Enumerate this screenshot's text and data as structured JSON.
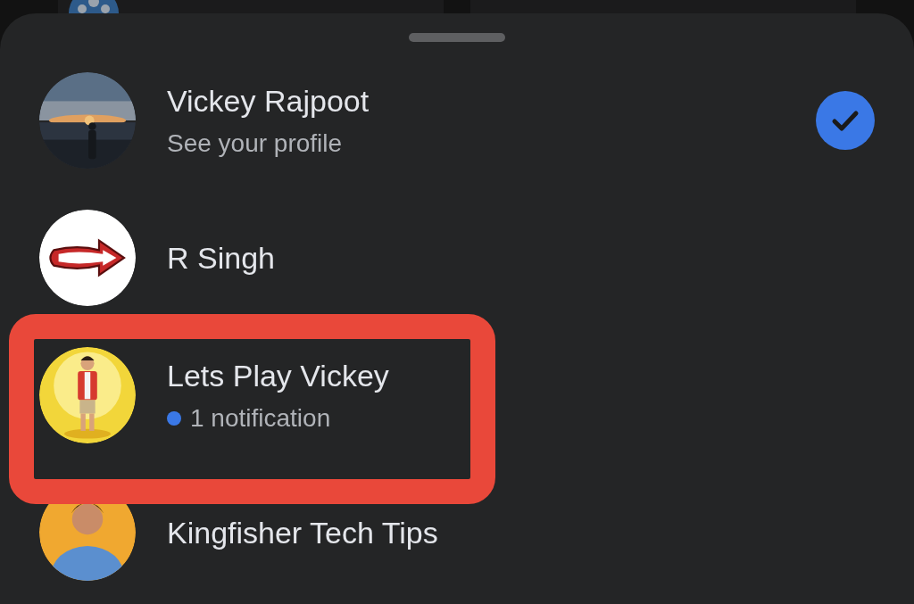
{
  "sheet": {
    "accounts": [
      {
        "name": "Vickey Rajpoot",
        "subtitle": "See your profile",
        "selected": true,
        "highlighted": false
      },
      {
        "name": "R Singh",
        "selected": false,
        "highlighted": false
      },
      {
        "name": "Lets Play Vickey",
        "notification": "1 notification",
        "selected": false,
        "highlighted": true
      },
      {
        "name": "Kingfisher Tech Tips",
        "selected": false,
        "highlighted": false
      }
    ]
  }
}
